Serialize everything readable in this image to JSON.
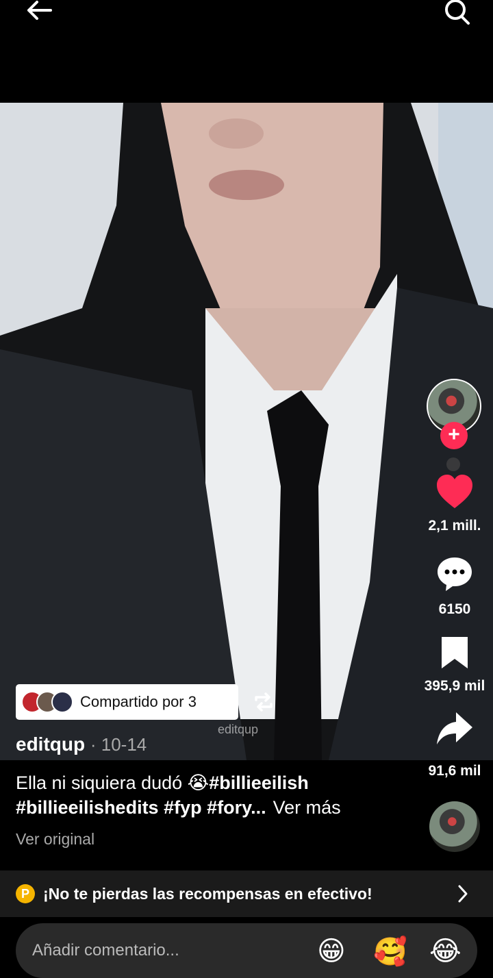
{
  "header": {
    "back_icon": "arrow-left-icon",
    "search_icon": "search-icon"
  },
  "video": {
    "watermark": "editqup"
  },
  "actions": {
    "likes": "2,1 mill.",
    "comments": "6150",
    "saves": "395,9 mil",
    "shares": "91,6 mil",
    "like_color": "#fe2c55"
  },
  "shared": {
    "label": "Compartido por 3"
  },
  "post": {
    "author": "editqup",
    "date": "· 10-14",
    "caption_text": "Ella ni siquiera dudó 😭",
    "caption_tag1": "#billieeilish",
    "caption_line2": "#billieeilishedits #fyp #fory...",
    "see_more": "Ver más",
    "see_original": "Ver original"
  },
  "rewards": {
    "coin": "P",
    "text": "¡No te pierdas las recompensas en efectivo!"
  },
  "comment": {
    "placeholder": "Añadir comentario...",
    "emojis": [
      "😁",
      "🥰",
      "😂"
    ]
  }
}
